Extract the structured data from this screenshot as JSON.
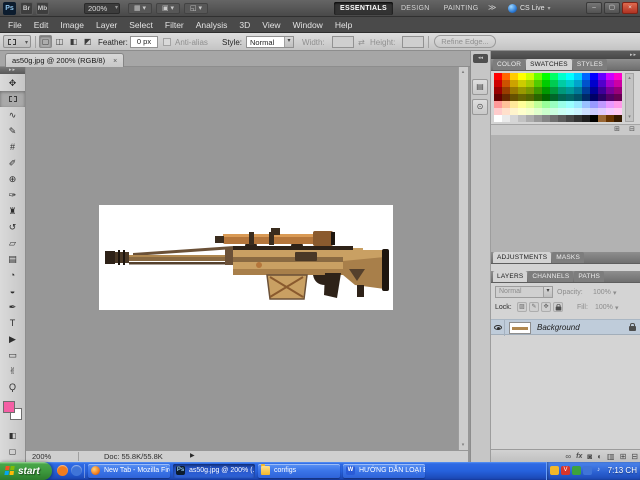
{
  "ui": {
    "caret": "▾",
    "arrow_up": "▴",
    "arrow_down": "▾"
  },
  "app_bar": {
    "ps_logo": "Ps",
    "br_icon": "Br",
    "mb_icon": "Mb",
    "zoom_display": "200%",
    "view_tool_icons": [
      {
        "name": "view-extras-icon",
        "glyph": "▦"
      },
      {
        "name": "arrange-documents-icon",
        "glyph": "▣"
      },
      {
        "name": "screen-mode-icon",
        "glyph": "◱"
      }
    ],
    "workspaces": [
      "ESSENTIALS",
      "DESIGN",
      "PAINTING"
    ],
    "active_workspace": "ESSENTIALS",
    "workspace_overflow": "≫",
    "cs_live_label": "CS Live",
    "window_buttons": {
      "minimize": "–",
      "maximize": "▢",
      "close": "×"
    }
  },
  "menu_bar": {
    "items": [
      "File",
      "Edit",
      "Image",
      "Layer",
      "Select",
      "Filter",
      "Analysis",
      "3D",
      "View",
      "Window",
      "Help"
    ]
  },
  "options_bar": {
    "combine_icons": [
      {
        "name": "new-selection-icon",
        "glyph": "▢",
        "active": true
      },
      {
        "name": "add-to-selection-icon",
        "glyph": "◫"
      },
      {
        "name": "subtract-from-selection-icon",
        "glyph": "◧"
      },
      {
        "name": "intersect-selection-icon",
        "glyph": "◩"
      }
    ],
    "feather_label": "Feather:",
    "feather_value": "0 px",
    "antialias_label": "Anti-alias",
    "style_label": "Style:",
    "style_value": "Normal",
    "width_label": "Width:",
    "swap_icon": "⇄",
    "height_label": "Height:",
    "refine_edge_label": "Refine Edge..."
  },
  "document": {
    "tab_title": "as50g.jpg @ 200% (RGB/8)",
    "close_glyph": "×",
    "status_zoom": "200%",
    "status_doc": "Doc: 55.8K/55.8K",
    "status_arrow": "▶"
  },
  "canvas_image": {
    "subject": "AS50 sniper rifle illustration facing left",
    "background": "#ffffff",
    "palette": [
      "#c9a063",
      "#a87f4a",
      "#8a6a42",
      "#6b5138",
      "#4a3826",
      "#2e2218",
      "#b5763b",
      "#d99a55"
    ]
  },
  "toolbox": {
    "expand_glyph": "▸▸",
    "tools": [
      {
        "name": "move-tool",
        "glyph": "✥"
      },
      {
        "name": "rectangular-marquee-tool",
        "glyph": "",
        "css": "marquee",
        "active": true
      },
      {
        "name": "lasso-tool",
        "glyph": "∿"
      },
      {
        "name": "quick-selection-tool",
        "glyph": "✎"
      },
      {
        "name": "crop-tool",
        "glyph": "#"
      },
      {
        "name": "eyedropper-tool",
        "glyph": "✐"
      },
      {
        "name": "spot-healing-brush-tool",
        "glyph": "⊕"
      },
      {
        "name": "brush-tool",
        "glyph": "✑"
      },
      {
        "name": "clone-stamp-tool",
        "glyph": "♜"
      },
      {
        "name": "history-brush-tool",
        "glyph": "↺"
      },
      {
        "name": "eraser-tool",
        "glyph": "▱"
      },
      {
        "name": "gradient-tool",
        "glyph": "▤"
      },
      {
        "name": "blur-tool",
        "glyph": "◔"
      },
      {
        "name": "dodge-tool",
        "glyph": "◒"
      },
      {
        "name": "pen-tool",
        "glyph": "✒"
      },
      {
        "name": "type-tool",
        "glyph": "T"
      },
      {
        "name": "path-selection-tool",
        "glyph": "▶"
      },
      {
        "name": "rectangle-tool",
        "glyph": "▭"
      },
      {
        "name": "hand-tool",
        "glyph": "✌"
      },
      {
        "name": "zoom-tool",
        "glyph": "Ϙ"
      }
    ],
    "foreground_color": "#f45fa4",
    "background_color": "#ffffff",
    "quick_mask_glyph": "◧",
    "screen_mode_glyph": "▢"
  },
  "dock": {
    "strip_collapse_glyph": "◂◂",
    "collapse_glyph": "▸▸",
    "strip_icons": [
      {
        "name": "collapsed-panel-icon-1",
        "glyph": "▤"
      },
      {
        "name": "collapsed-panel-icon-2",
        "glyph": "⊙"
      }
    ],
    "color_group": {
      "tabs": [
        "COLOR",
        "SWATCHES",
        "STYLES"
      ],
      "active": "SWATCHES"
    },
    "swatch_rows": [
      [
        "#ff0000",
        "#ff6600",
        "#ffcc00",
        "#ffff00",
        "#ccff00",
        "#66ff00",
        "#00ff00",
        "#00ff66",
        "#00ffcc",
        "#00ffff",
        "#00ccff",
        "#0066ff",
        "#0000ff",
        "#6600ff",
        "#cc00ff",
        "#ff00cc"
      ],
      [
        "#cc0000",
        "#cc5200",
        "#cca300",
        "#cccc00",
        "#a3cc00",
        "#52cc00",
        "#00cc00",
        "#00cc52",
        "#00cca3",
        "#00cccc",
        "#00a3cc",
        "#0052cc",
        "#0000cc",
        "#5200cc",
        "#a300cc",
        "#cc00a3"
      ],
      [
        "#990000",
        "#993d00",
        "#997a00",
        "#999900",
        "#7a9900",
        "#3d9900",
        "#009900",
        "#00993d",
        "#00997a",
        "#009999",
        "#007a99",
        "#003d99",
        "#000099",
        "#3d0099",
        "#7a0099",
        "#99007a"
      ],
      [
        "#660000",
        "#662900",
        "#665200",
        "#666600",
        "#526600",
        "#296600",
        "#006600",
        "#006629",
        "#006652",
        "#006666",
        "#005266",
        "#002966",
        "#000066",
        "#290066",
        "#520066",
        "#660052"
      ],
      [
        "#ff9999",
        "#ffc199",
        "#ffe999",
        "#ffff99",
        "#e9ff99",
        "#c1ff99",
        "#99ff99",
        "#99ffc1",
        "#99ffe9",
        "#99ffff",
        "#99e9ff",
        "#99c1ff",
        "#9999ff",
        "#c199ff",
        "#e999ff",
        "#ff99e9"
      ],
      [
        "#ffcccc",
        "#ffe0cc",
        "#fff4cc",
        "#ffffcc",
        "#f4ffcc",
        "#e0ffcc",
        "#ccffcc",
        "#ccffe0",
        "#ccfff4",
        "#ccffff",
        "#ccf4ff",
        "#cce0ff",
        "#ccccff",
        "#e0ccff",
        "#f4ccff",
        "#ffccf4"
      ],
      [
        "#ffffff",
        "#ebebeb",
        "#d6d6d6",
        "#c2c2c2",
        "#adadad",
        "#999999",
        "#858585",
        "#707070",
        "#5c5c5c",
        "#474747",
        "#333333",
        "#1f1f1f",
        "#000000",
        "#996633",
        "#663300",
        "#331900"
      ]
    ],
    "swatches_footer_icons": [
      {
        "name": "new-swatch-icon",
        "glyph": "⊞"
      },
      {
        "name": "delete-swatch-icon",
        "glyph": "⊟"
      }
    ],
    "adjust_group": {
      "tabs": [
        "ADJUSTMENTS",
        "MASKS"
      ],
      "active": "ADJUSTMENTS"
    },
    "layers_group": {
      "tabs": [
        "LAYERS",
        "CHANNELS",
        "PATHS"
      ],
      "active": "LAYERS"
    },
    "layers": {
      "blend_mode": "Normal",
      "opacity_label": "Opacity:",
      "opacity_value": "100%",
      "lock_label": "Lock:",
      "lock_icons": [
        {
          "name": "lock-transparency-icon",
          "glyph": "▨"
        },
        {
          "name": "lock-pixels-icon",
          "glyph": "✎"
        },
        {
          "name": "lock-position-icon",
          "glyph": "✥"
        },
        {
          "name": "lock-all-icon",
          "glyph": "padlock"
        }
      ],
      "fill_label": "Fill:",
      "fill_value": "100%",
      "rows": [
        {
          "name": "Background",
          "visible": true,
          "locked": true
        }
      ],
      "footer_icons": [
        {
          "name": "link-layers-icon",
          "glyph": "∞"
        },
        {
          "name": "layer-style-icon",
          "glyph": "fx"
        },
        {
          "name": "add-layer-mask-icon",
          "glyph": "◙"
        },
        {
          "name": "adjustment-layer-icon",
          "glyph": "◐"
        },
        {
          "name": "new-group-icon",
          "glyph": "▥"
        },
        {
          "name": "new-layer-icon",
          "glyph": "⊞"
        },
        {
          "name": "delete-layer-icon",
          "glyph": "⊟"
        }
      ]
    }
  },
  "taskbar": {
    "start_label": "start",
    "start_flag_colors": [
      "#f35325",
      "#81bc06",
      "#05a6f0",
      "#ffba08"
    ],
    "quick_launch_icons": [
      {
        "name": "quick-launch-icon-1",
        "color": "#f07c1e"
      },
      {
        "name": "quick-launch-icon-2",
        "color": "#3f74d8"
      }
    ],
    "buttons": [
      {
        "label": "New Tab - Mozilla Fire...",
        "icon": "firefox",
        "icon_text": "",
        "active": false
      },
      {
        "label": "as50g.jpg @ 200% (...",
        "icon": "photoshop",
        "icon_text": "Ps",
        "active": true
      },
      {
        "label": "configs",
        "icon": "folder",
        "icon_text": "",
        "active": false
      },
      {
        "label": "HƯỚNG DẪN LOẠI B...",
        "icon": "word",
        "icon_text": "W",
        "active": false
      }
    ],
    "tray_icons": [
      {
        "name": "tray-icon-1",
        "color": "#f2b72a",
        "glyph": ""
      },
      {
        "name": "tray-unikey-icon",
        "color": "#d8352a",
        "glyph": "V"
      },
      {
        "name": "tray-icon-3",
        "color": "#3da23d",
        "glyph": ""
      },
      {
        "name": "tray-icon-4",
        "color": "#3f74d8",
        "glyph": ""
      },
      {
        "name": "tray-volume-icon",
        "color": "",
        "glyph": "♪"
      }
    ],
    "clock": "7:13 CH"
  }
}
